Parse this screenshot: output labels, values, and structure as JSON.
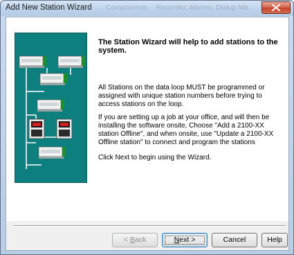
{
  "window": {
    "title": "Add New Station Wizard",
    "background_titles": [
      "Components",
      "Recorder, Alarms, Dialup Ma"
    ]
  },
  "wizard": {
    "heading": "The Station Wizard will help to add stations to the system.",
    "paragraphs": [
      "All Stations on the data loop MUST be programmed or assigned with unique station numbers before trying to access stations on the loop.",
      "If you are setting up a job at your office, and will then be installing the software onsite, Choose \"Add a 2100-XX station Offline\", and when onsite, use \"Update a 2100-XX Offline station\" to connect and program the stations",
      "Click Next to begin using the Wizard."
    ]
  },
  "buttons": {
    "back": {
      "prefix": "< ",
      "mnemonic": "B",
      "rest": "ack"
    },
    "next": {
      "mnemonic": "N",
      "rest": "ext >"
    },
    "cancel": "Cancel",
    "help": "Help"
  },
  "colors": {
    "illustration_bg": "#0e7f7f",
    "line": "#ffffff",
    "device_green": "#1f8f2a",
    "lcd_red": "#d62020"
  }
}
